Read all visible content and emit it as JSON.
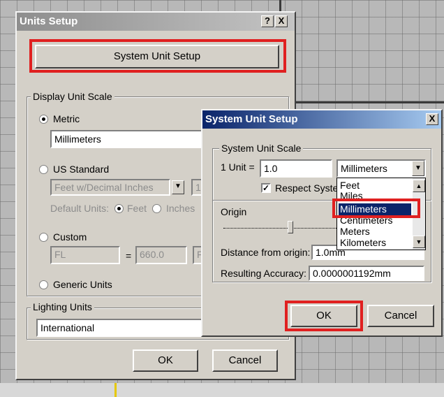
{
  "units_setup": {
    "title": "Units Setup",
    "help_btn": "?",
    "close_btn": "X",
    "system_unit_setup_button": "System Unit Setup",
    "display_unit_scale": {
      "legend": "Display Unit Scale",
      "metric_label": "Metric",
      "metric_value": "Millimeters",
      "us_standard_label": "US Standard",
      "us_value": "Feet w/Decimal Inches",
      "us_value2": "1",
      "default_units_label": "Default Units:",
      "feet_label": "Feet",
      "inches_label": "Inches",
      "custom_label": "Custom",
      "custom_field": "FL",
      "equals": "=",
      "custom_value": "660.0",
      "custom_unit": "F",
      "generic_units_label": "Generic Units"
    },
    "lighting_units": {
      "legend": "Lighting Units",
      "value": "International"
    },
    "ok_label": "OK",
    "cancel_label": "Cancel"
  },
  "system_unit_setup": {
    "title": "System Unit Setup",
    "close_btn": "X",
    "scale_legend": "System Unit Scale",
    "unit_label": "1 Unit =",
    "unit_value": "1.0",
    "unit_dropdown_value": "Millimeters",
    "respect_label": "Respect Syste",
    "respect_checked": true,
    "unit_options": [
      "Feet",
      "Miles",
      "Millimeters",
      "Centimeters",
      "Meters",
      "Kilometers"
    ],
    "selected_option": "Millimeters",
    "origin_label": "Origin",
    "distance_label": "Distance from origin:",
    "distance_value": "1.0mm",
    "accuracy_label": "Resulting Accuracy:",
    "accuracy_value": "0.0000001192mm",
    "ok_label": "OK",
    "cancel_label": "Cancel"
  },
  "colors": {
    "dialog_face": "#d4d0c8",
    "active_title": "#0a246a",
    "inactive_title": "#8e8e8e",
    "highlight_box": "#e02020",
    "selection": "#0a246a"
  }
}
